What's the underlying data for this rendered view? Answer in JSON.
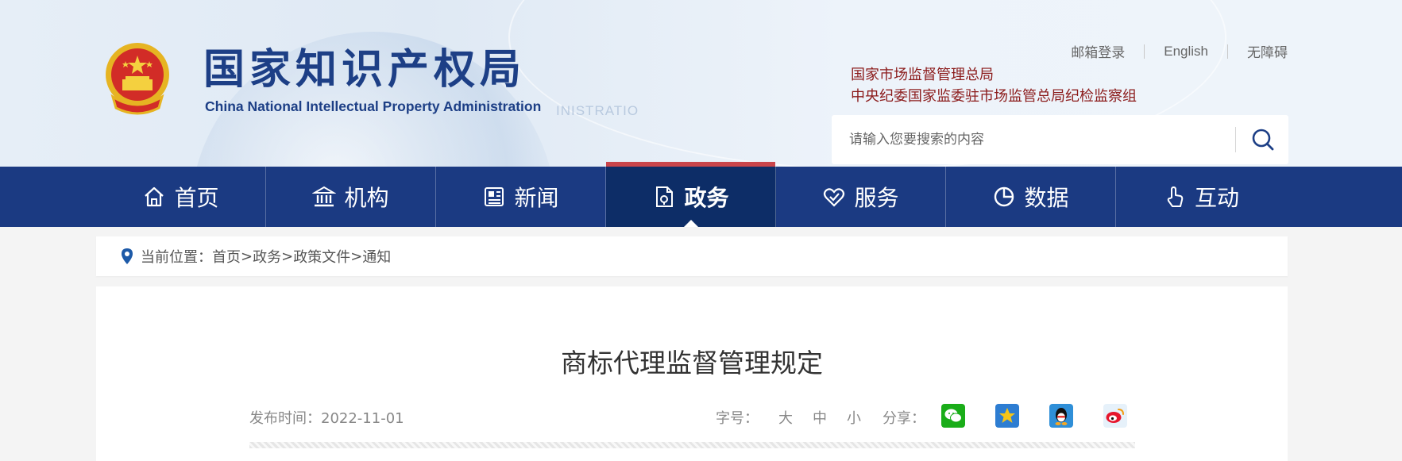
{
  "header": {
    "logo_cn": "国家知识产权局",
    "logo_en": "China National Intellectual Property Administration",
    "ghost_text": "INISTRATIO",
    "top_links": [
      "邮箱登录",
      "English",
      "无障碍"
    ],
    "sub_links": [
      "国家市场监督管理总局",
      "中央纪委国家监委驻市场监管总局纪检监察组"
    ],
    "search": {
      "placeholder": "请输入您要搜索的内容"
    }
  },
  "nav": {
    "items": [
      {
        "label": "首页",
        "icon": "home-icon"
      },
      {
        "label": "机构",
        "icon": "institution-icon"
      },
      {
        "label": "新闻",
        "icon": "news-icon"
      },
      {
        "label": "政务",
        "icon": "government-affairs-icon",
        "active": true
      },
      {
        "label": "服务",
        "icon": "service-icon"
      },
      {
        "label": "数据",
        "icon": "data-chart-icon"
      },
      {
        "label": "互动",
        "icon": "interaction-hand-icon"
      }
    ]
  },
  "breadcrumb": {
    "prefix": "当前位置：",
    "items": [
      "首页",
      "政务",
      "政策文件",
      "通知"
    ],
    "separator": ">"
  },
  "article": {
    "title": "商标代理监督管理规定",
    "date_label": "发布时间：",
    "date": "2022-11-01",
    "font_label": "字号：",
    "font_options": [
      "大",
      "中",
      "小"
    ],
    "share_label": "分享：",
    "share_targets": [
      "wechat-icon",
      "qzone-icon",
      "qq-icon",
      "weibo-icon"
    ]
  },
  "colors": {
    "nav_bg": "#1b3a82",
    "nav_active_bg": "#0d2d67",
    "nav_active_top": "#c9454b",
    "logo": "#1d3f86",
    "sub_links": "#8b1a1a"
  }
}
